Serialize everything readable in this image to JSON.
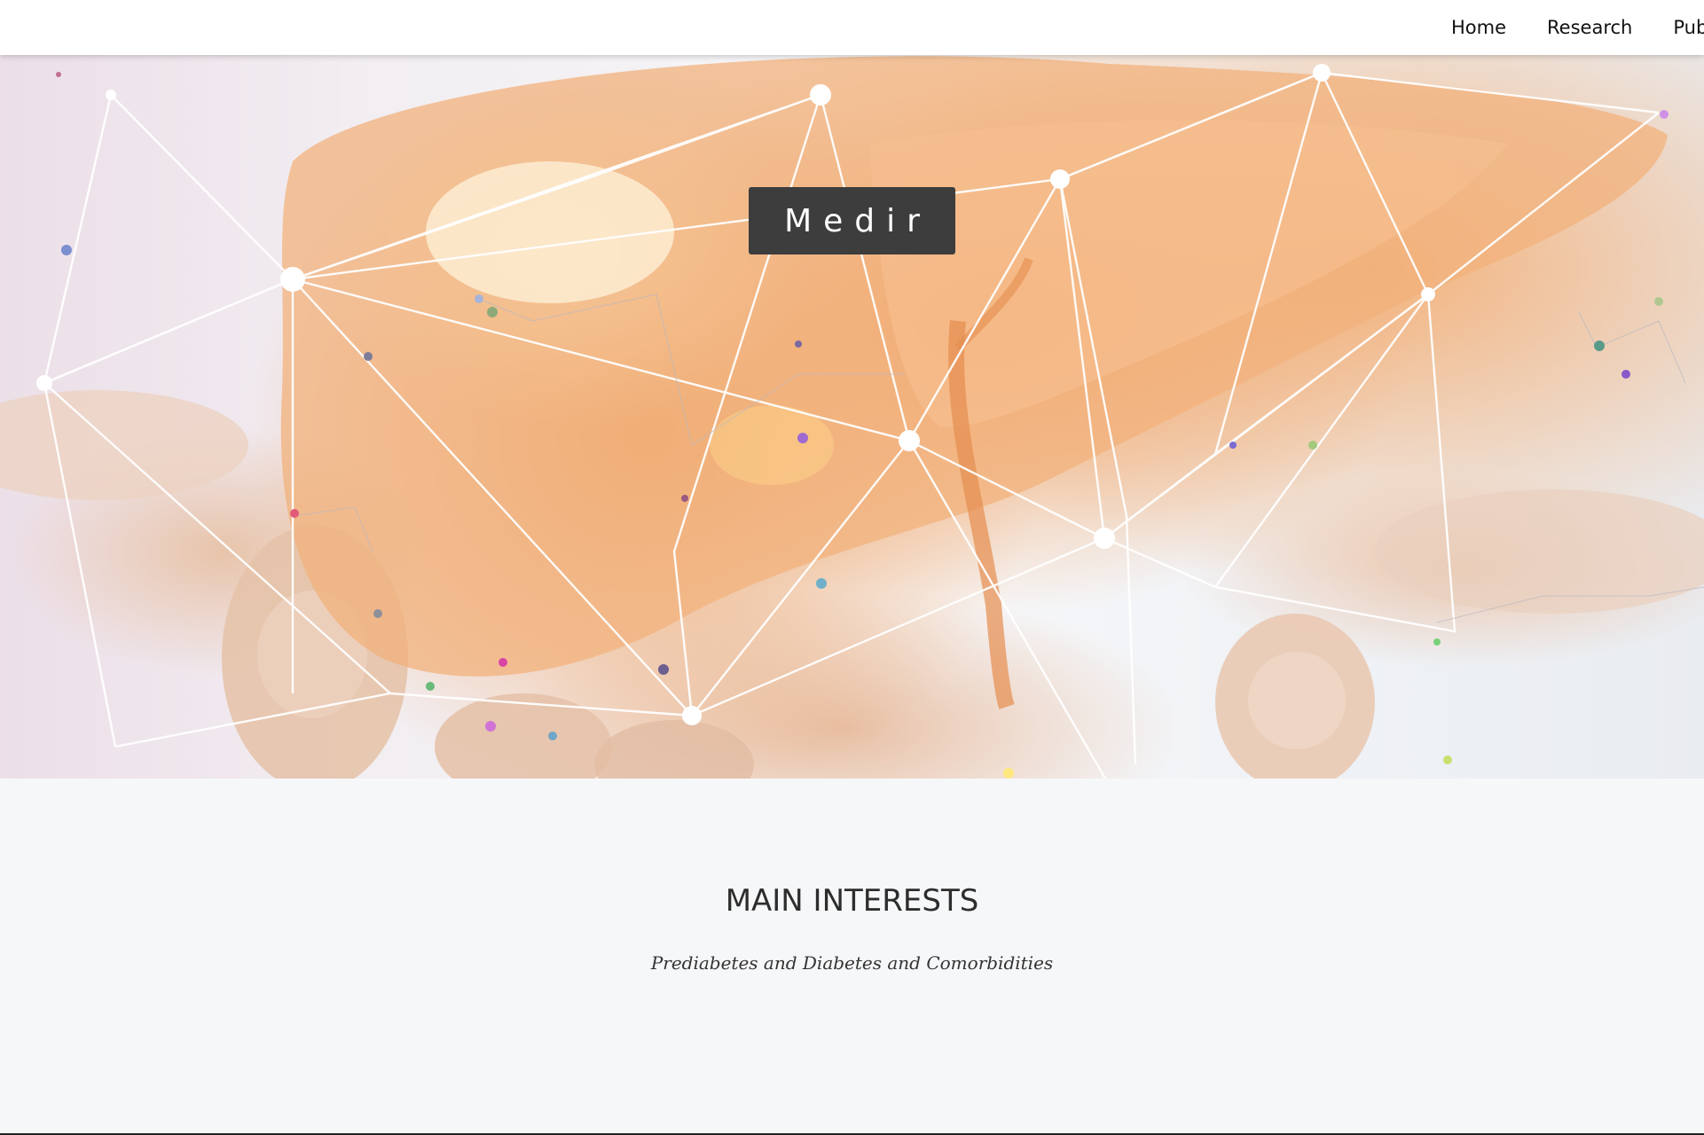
{
  "nav": {
    "items": [
      {
        "label": "Home"
      },
      {
        "label": "Research"
      },
      {
        "label": "Publi"
      }
    ]
  },
  "hero": {
    "brand": "Medir",
    "image_icon": "liver-network-illustration"
  },
  "interests": {
    "title": "MAIN INTERESTS",
    "subtitle": "Prediabetes and Diabetes and Comorbidities"
  },
  "colors": {
    "nav_bg": "#ffffff",
    "brand_bg": "#3d3d3d",
    "page_bg": "#f6f7f9",
    "hero_accent": "#f0a060"
  }
}
